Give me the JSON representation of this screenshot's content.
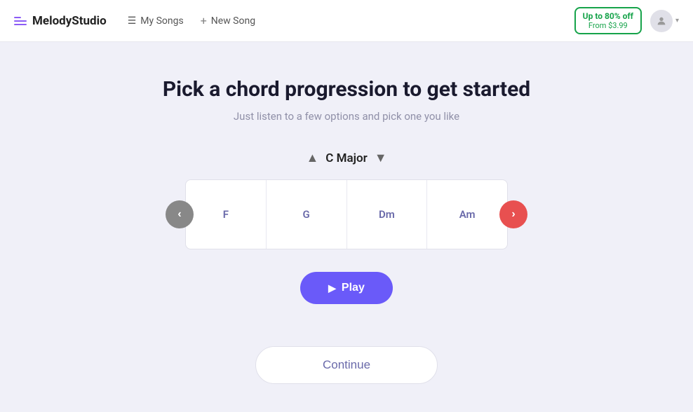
{
  "nav": {
    "logo": "MelodyStudio",
    "my_songs_label": "My Songs",
    "new_song_label": "New Song",
    "promo_top": "Up to 80% off",
    "promo_bottom": "From $3.99"
  },
  "page": {
    "title": "Pick a chord progression to get started",
    "subtitle": "Just listen to a few options and pick one you like",
    "key_up_icon": "▲",
    "key_name": "C  Major",
    "key_down_icon": "▼",
    "chords": [
      {
        "label": "F"
      },
      {
        "label": "G"
      },
      {
        "label": "Dm"
      },
      {
        "label": "Am"
      }
    ],
    "play_label": "Play",
    "continue_label": "Continue"
  }
}
